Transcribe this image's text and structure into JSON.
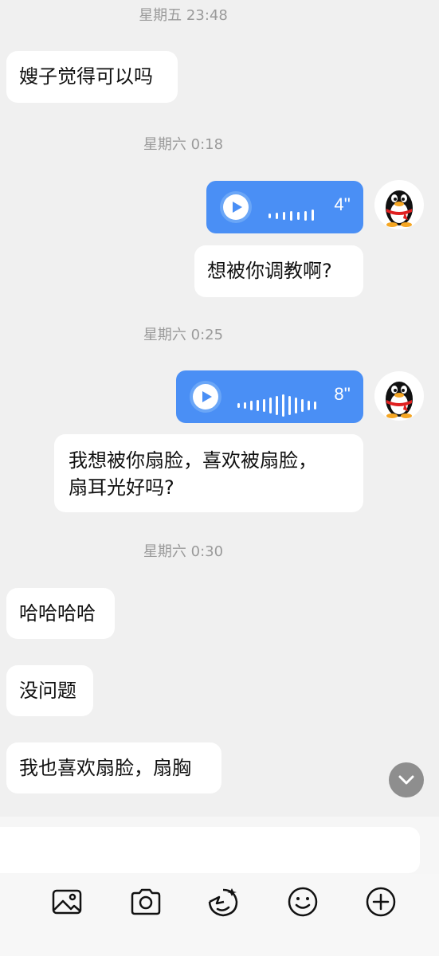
{
  "timestamps": [
    "星期五 23:48",
    "星期六 0:18",
    "星期六 0:25",
    "星期六 0:30"
  ],
  "messages": {
    "m1": "嫂子觉得可以吗",
    "m2": "想被你调教啊?",
    "m3_line1": "我想被你扇脸，喜欢被扇脸，",
    "m3_line2": "扇耳光好吗?",
    "m4": "哈哈哈哈",
    "m5": "没问题",
    "m6": "我也喜欢扇脸，扇胸"
  },
  "voice": [
    {
      "duration": "4''"
    },
    {
      "duration": "8''"
    }
  ],
  "colors": {
    "voice_bubble": "#4a8ff5",
    "background": "#f0f0f0",
    "bubble": "#ffffff"
  },
  "icons": [
    "image-icon",
    "camera-icon",
    "sticker-icon",
    "emoji-icon",
    "plus-icon",
    "chevron-down-icon",
    "play-icon",
    "qq-penguin-avatar"
  ]
}
